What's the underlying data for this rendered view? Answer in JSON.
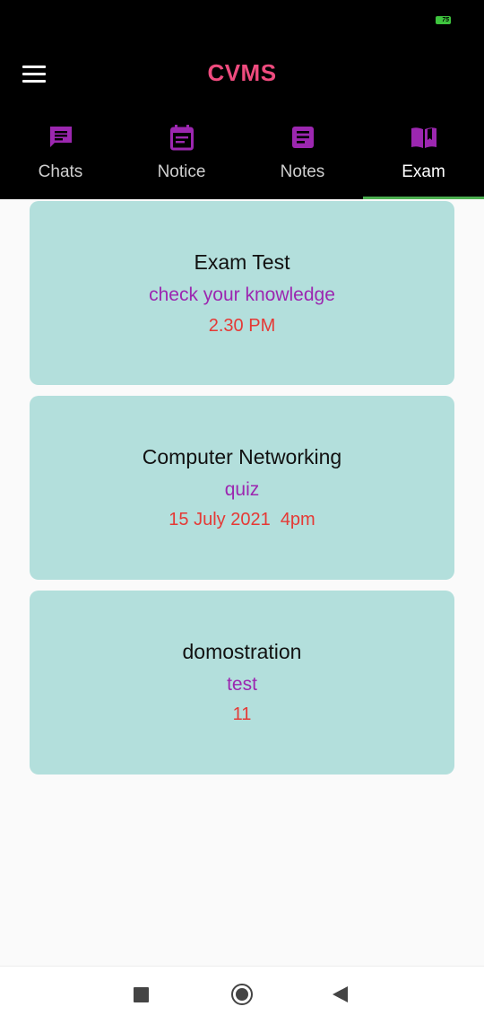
{
  "app": {
    "title": "CVMS",
    "battery": "75"
  },
  "tabs": [
    {
      "label": "Chats",
      "icon": "chat-icon",
      "active": false
    },
    {
      "label": "Notice",
      "icon": "calendar-notice-icon",
      "active": false
    },
    {
      "label": "Notes",
      "icon": "notes-icon",
      "active": false
    },
    {
      "label": "Exam",
      "icon": "book-open-icon",
      "active": true
    }
  ],
  "exams": [
    {
      "title": "Exam Test",
      "subtitle": "check your knowledge",
      "time": "2.30 PM"
    },
    {
      "title": "Computer Networking",
      "subtitle": "quiz",
      "time": "15 July 2021  4pm"
    },
    {
      "title": "domostration",
      "subtitle": "test",
      "time": "11"
    }
  ],
  "colors": {
    "title": "#ee4b7e",
    "icon": "#9c27b0",
    "card": "#b3dfdc",
    "subtitle": "#9c27b0",
    "time": "#e53935",
    "tab_indicator": "#4caf50"
  },
  "system_nav": [
    "recents-square-icon",
    "home-circle-icon",
    "back-triangle-icon"
  ]
}
